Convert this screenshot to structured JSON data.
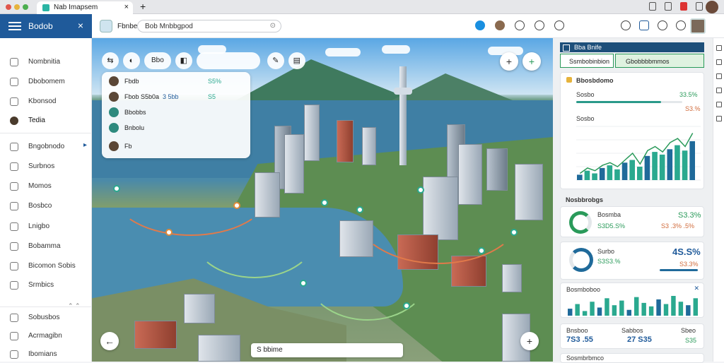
{
  "browser": {
    "tab_title": "Nab Imapsem"
  },
  "app": {
    "brand": "Bodob",
    "name": "Fbnbe",
    "search_value": "Bob Mnbbgpod"
  },
  "sidebar": {
    "items": [
      {
        "label": "Nombnitia"
      },
      {
        "label": "Dbobomem"
      },
      {
        "label": "Kbonsod"
      },
      {
        "label": "Tedia"
      },
      {
        "label": "Bngobnodo"
      },
      {
        "label": "Surbnos"
      },
      {
        "label": "Momos"
      },
      {
        "label": "Bosbco"
      },
      {
        "label": "Lnigbo"
      },
      {
        "label": "Bobamma"
      },
      {
        "label": "Bicomon Sobis"
      },
      {
        "label": "Srmbics"
      },
      {
        "label": "Sobusbos"
      },
      {
        "label": "Acrmagibn"
      },
      {
        "label": "Ibomians"
      }
    ]
  },
  "map": {
    "toolbar_pill": "Bbo",
    "panel_rows": [
      {
        "name": "Fbdb",
        "v1": "",
        "v2": "S5%",
        "v3": ""
      },
      {
        "name": "Fbob S5b0a",
        "v1": "3 5bb",
        "v2": "S5",
        "v3": ""
      },
      {
        "name": "Bbobbs",
        "v1": "",
        "v2": "",
        "v3": ""
      },
      {
        "name": "Bnbolu",
        "v1": "",
        "v2": "",
        "v3": ""
      },
      {
        "name": "Fb",
        "v1": "",
        "v2": "",
        "v3": ""
      }
    ],
    "bottom_search": "S bbime"
  },
  "right": {
    "header": "Bba Bnife",
    "tab1": "Ssmbobinbion",
    "tab2": "Gbobbbbmmos",
    "section1_title": "Bbosbdomo",
    "row1_label": "Sosbo",
    "row1_value": "33.5%",
    "row2_value": "S3.%",
    "chart_label": "Sosbo",
    "section2_title": "Nosbbrobgs",
    "kpi1_label": "Bosmba",
    "kpi1_value": "S3.3%",
    "kpi1_sub": "S3D5.S%",
    "kpi1_sub2": "S3 .3% .5%",
    "kpi2_label": "Surbo",
    "kpi2_value": "4S.S%",
    "kpi2_sub": "S3S3.%",
    "kpi2_sub2": "S3.3%",
    "card3_label": "Bosmboboo",
    "card4_label_a": "Bnsboo",
    "card4_label_b": "Sabbos",
    "card4_label_c": "Sbeo",
    "card4_val_a": "7S3 .55",
    "card4_val_b": "27 S35",
    "card4_val_c": "S35",
    "card5_label": "Sosmbrbmco"
  },
  "chart_data": {
    "type": "bar",
    "categories": [],
    "values": [
      8,
      14,
      10,
      18,
      22,
      16,
      26,
      30,
      20,
      36,
      42,
      38,
      46,
      52,
      44,
      58
    ],
    "line": [
      10,
      18,
      14,
      22,
      26,
      20,
      30,
      40,
      24,
      44,
      50,
      42,
      56,
      62,
      50,
      70
    ],
    "ylim": [
      0,
      80
    ]
  },
  "chart_data_small": {
    "type": "bar",
    "values": [
      12,
      20,
      8,
      24,
      14,
      30,
      18,
      26,
      10,
      32,
      22,
      16,
      28,
      20,
      34,
      24,
      18,
      30
    ]
  }
}
